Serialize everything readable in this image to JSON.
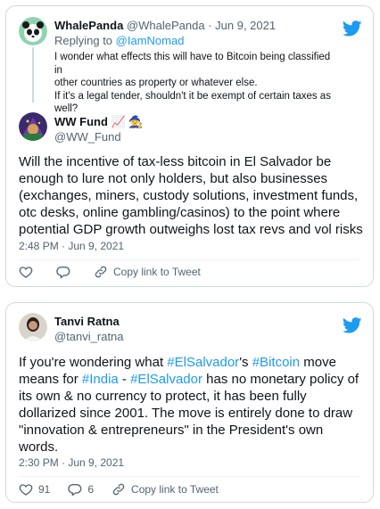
{
  "tweet1": {
    "parent": {
      "name": "WhalePanda",
      "handle": "@WhalePanda",
      "separator": "·",
      "date": "Jun 9, 2021",
      "replying_prefix": "Replying to ",
      "replying_to": "@IamNomad",
      "text_line1": "I wonder what effects this will have to Bitcoin being classified in",
      "text_line2": "other countries as property or whatever else.",
      "text_line3": "If it's a legal tender, shouldn't it be exempt of certain taxes as",
      "text_line4": "well?"
    },
    "author": {
      "name": "WW Fund 📈 🧙",
      "handle": "@WW_Fund"
    },
    "text_line1": "Will the incentive of tax-less bitcoin in El Salvador be",
    "text_line2": "enough to lure not only holders, but also businesses",
    "text_line3": "(exchanges, miners, custody solutions, investment funds,",
    "text_line4": "otc desks, online gambling/casinos) to the point where",
    "text_line5": "potential GDP growth outweighs lost tax revs and vol risks",
    "timestamp": "2:48 PM · Jun 9, 2021",
    "copy_link_label": "Copy link to Tweet"
  },
  "tweet2": {
    "author": {
      "name": "Tanvi Ratna",
      "handle": "@tanvi_ratna"
    },
    "l1_a": "If you're wondering what ",
    "l1_tag1": "#ElSalvador",
    "l1_b": "'s ",
    "l1_tag2": "#Bitcoin",
    "l1_c": " move",
    "l2_a": "means for ",
    "l2_tag1": "#India",
    "l2_b": " - ",
    "l2_tag2": "#ElSalvador",
    "l2_c": " has no monetary policy of",
    "text_line3": "its own & no currency to protect, it has been fully",
    "text_line4": "dollarized since 2001. The move is entirely done to draw",
    "text_line5": "\"innovation & entrepreneurs\" in the President's own",
    "text_line6": "words.",
    "timestamp": "2:30 PM · Jun 9, 2021",
    "likes": "91",
    "replies": "6",
    "copy_link_label": "Copy link to Tweet"
  },
  "colors": {
    "accent": "#1d9bf0",
    "secondary_text": "#536471",
    "border": "#cfd9de"
  },
  "icons": [
    "twitter-bird-icon",
    "heart-icon",
    "reply-icon",
    "link-icon"
  ]
}
